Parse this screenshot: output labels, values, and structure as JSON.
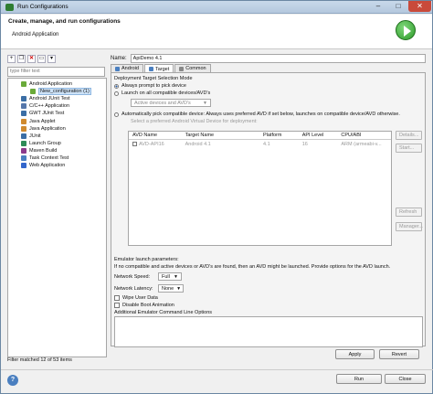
{
  "window": {
    "title": "Run Configurations",
    "min": "–",
    "max": "□",
    "close": "✕"
  },
  "banner": {
    "heading": "Create, manage, and run configurations",
    "subtitle": "Android Application"
  },
  "left": {
    "toolbar": [
      "new-config",
      "duplicate",
      "delete",
      "collapse",
      "filter"
    ],
    "filter_placeholder": "type filter text",
    "tree": [
      {
        "label": "Android Application",
        "indent": 1,
        "color": "#6aaa3a"
      },
      {
        "label": "New_configuration (1)",
        "indent": 2,
        "color": "#6aaa3a",
        "selected": true
      },
      {
        "label": "Android JUnit Test",
        "indent": 1,
        "color": "#3b6ea5"
      },
      {
        "label": "C/C++ Application",
        "indent": 1,
        "color": "#5577aa"
      },
      {
        "label": "GWT JUnit Test",
        "indent": 1,
        "color": "#3b6ea5"
      },
      {
        "label": "Java Applet",
        "indent": 1,
        "color": "#d08a2e"
      },
      {
        "label": "Java Application",
        "indent": 1,
        "color": "#d08a2e"
      },
      {
        "label": "JUnit",
        "indent": 1,
        "color": "#3b6ea5"
      },
      {
        "label": "Launch Group",
        "indent": 1,
        "color": "#2e8b57"
      },
      {
        "label": "Maven Build",
        "indent": 1,
        "color": "#8b3a8b"
      },
      {
        "label": "Task Context Test",
        "indent": 1,
        "color": "#4a7fc0"
      },
      {
        "label": "Web Application",
        "indent": 1,
        "color": "#3366cc"
      }
    ],
    "status": "Filter matched 12 of 53 items"
  },
  "right": {
    "name_label": "Name:",
    "name_value": "ApiDemo 4.1",
    "tabs": [
      "Android",
      "Target",
      "Common"
    ],
    "section_title": "Deployment Target Selection Mode",
    "opt1": "Always prompt to pick device",
    "opt2": "Launch on all compatible devices/AVD's",
    "opt2_combo": "Active devices and AVD's",
    "opt3": "Automatically pick compatible device: Always uses preferred AVD if set below, launches on compatible device/AVD otherwise.",
    "opt3_hint": "Select a preferred Android Virtual Device for deployment:",
    "table": {
      "headers": [
        "AVD Name",
        "Target Name",
        "Platform",
        "API Level",
        "CPU/ABI"
      ],
      "rows": [
        [
          "AVD-API16",
          "Android 4.1",
          "4.1",
          "16",
          "ARM (armeabi-v..."
        ]
      ]
    },
    "side_buttons": [
      "Details...",
      "Start...",
      "Refresh",
      "Manager..."
    ],
    "emu_title": "Emulator launch parameters:",
    "emu_note": "If no compatible and active devices or AVD's are found, then an AVD might be launched. Provide options for the AVD launch.",
    "net_speed_label": "Network Speed:",
    "net_speed_value": "Full",
    "net_latency_label": "Network Latency:",
    "net_latency_value": "None",
    "wipe": "Wipe User Data",
    "boot_anim": "Disable Boot Animation",
    "cmdline": "Additional Emulator Command Line Options",
    "apply": "Apply",
    "revert": "Revert"
  },
  "footer": {
    "run": "Run",
    "close": "Close",
    "help": "?"
  }
}
